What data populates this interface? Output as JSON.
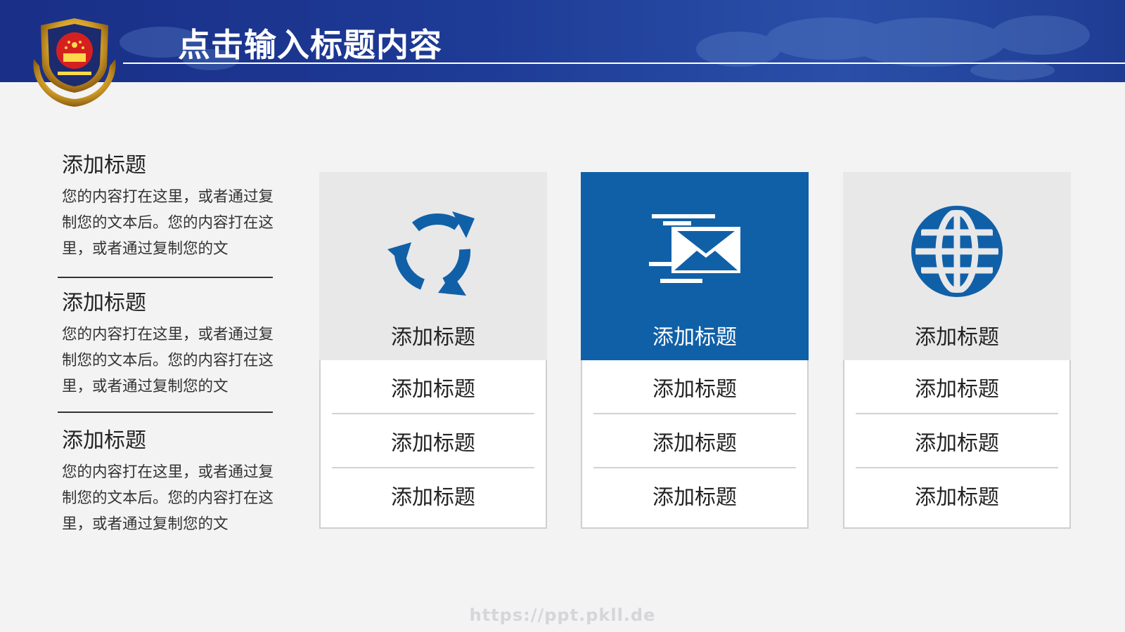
{
  "header": {
    "title": "点击输入标题内容"
  },
  "left_items": [
    {
      "title": "添加标题",
      "text": "您的内容打在这里，或者通过复制您的文本后。您的内容打在这里，或者通过复制您的文"
    },
    {
      "title": "添加标题",
      "text": "您的内容打在这里，或者通过复制您的文本后。您的内容打在这里，或者通过复制您的文"
    },
    {
      "title": "添加标题",
      "text": "您的内容打在这里，或者通过复制您的文本后。您的内容打在这里，或者通过复制您的文"
    }
  ],
  "cards": [
    {
      "icon": "recycle-icon",
      "title": "添加标题",
      "rows": [
        "添加标题",
        "添加标题",
        "添加标题"
      ]
    },
    {
      "icon": "mail-icon",
      "title": "添加标题",
      "rows": [
        "添加标题",
        "添加标题",
        "添加标题"
      ]
    },
    {
      "icon": "globe-icon",
      "title": "添加标题",
      "rows": [
        "添加标题",
        "添加标题",
        "添加标题"
      ]
    }
  ],
  "colors": {
    "brand_blue": "#1060a8",
    "header_blue": "#1d3a95",
    "card_gray": "#e8e8e9"
  },
  "watermark": "https://ppt.pkll.de"
}
